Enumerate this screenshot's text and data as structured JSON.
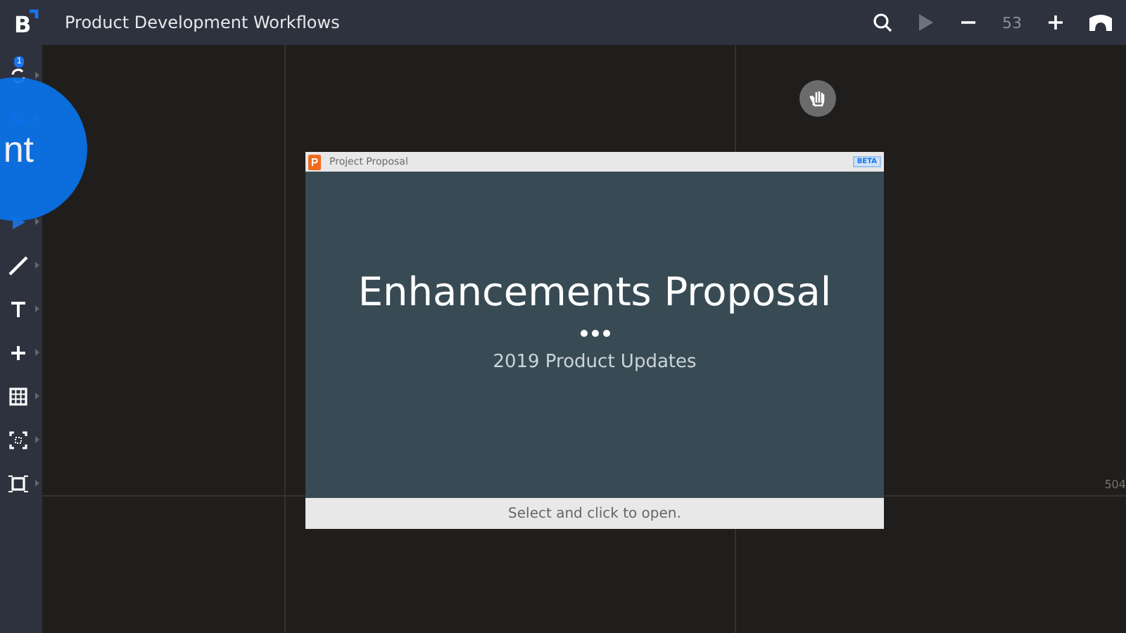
{
  "window": {
    "title": "Product Development Workflows",
    "logo": "B"
  },
  "toolbar": {
    "zoom": "53"
  },
  "sidebar": {
    "badge": "1",
    "tools": [
      {
        "kind": "sync"
      },
      {
        "kind": "phone"
      },
      {
        "kind": "pointer"
      },
      {
        "kind": "pen"
      },
      {
        "kind": "text"
      },
      {
        "kind": "plus"
      },
      {
        "kind": "table"
      },
      {
        "kind": "scan"
      },
      {
        "kind": "frame"
      }
    ]
  },
  "bubble": {
    "text": "nt"
  },
  "canvas": {
    "ruler_label": "504"
  },
  "card": {
    "title": "Project Proposal",
    "badge": "BETA",
    "slide_title": "Enhancements Proposal",
    "slide_subtitle": "2019 Product Updates",
    "footer": "Select and click to open."
  }
}
